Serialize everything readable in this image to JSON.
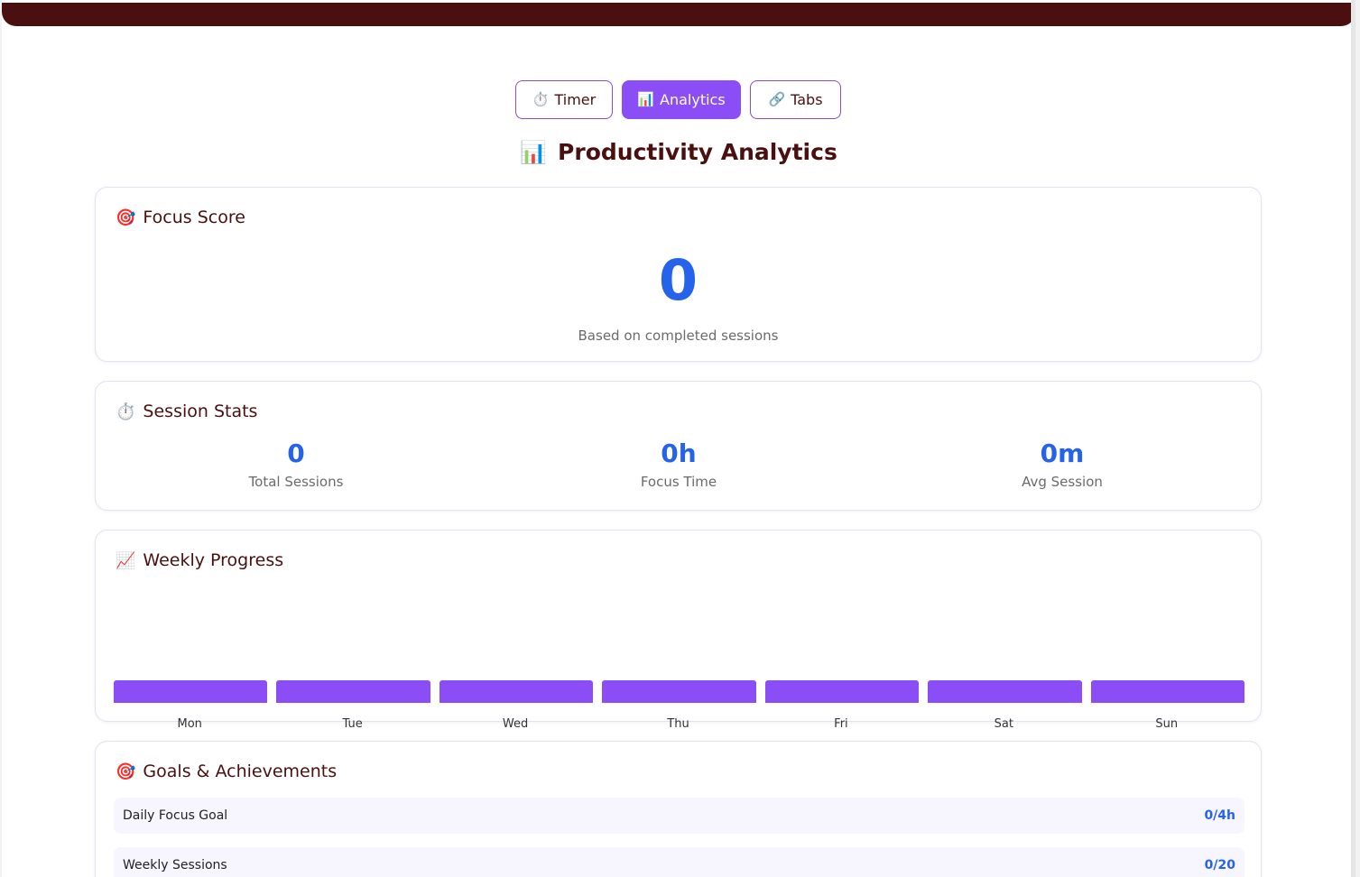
{
  "nav": {
    "tabs": [
      {
        "icon": "⏱️",
        "label": "Timer",
        "active": false
      },
      {
        "icon": "📊",
        "label": "Analytics",
        "active": true
      },
      {
        "icon": "🔗",
        "label": "Tabs",
        "active": false
      }
    ]
  },
  "page": {
    "title_icon": "📊",
    "title": "Productivity Analytics"
  },
  "focus_score": {
    "icon": "🎯",
    "title": "Focus Score",
    "value": "0",
    "note": "Based on completed sessions"
  },
  "session_stats": {
    "icon": "⏱️",
    "title": "Session Stats",
    "items": [
      {
        "value": "0",
        "label": "Total Sessions"
      },
      {
        "value": "0h",
        "label": "Focus Time"
      },
      {
        "value": "0m",
        "label": "Avg Session"
      }
    ]
  },
  "weekly_progress": {
    "icon": "📈",
    "title": "Weekly Progress",
    "bar_color": "#8b4df6"
  },
  "chart_data": {
    "type": "bar",
    "categories": [
      "Mon",
      "Tue",
      "Wed",
      "Thu",
      "Fri",
      "Sat",
      "Sun"
    ],
    "values": [
      0,
      0,
      0,
      0,
      0,
      0,
      0
    ],
    "title": "",
    "xlabel": "",
    "ylabel": ""
  },
  "goals": {
    "icon": "🎯",
    "title": "Goals & Achievements",
    "items": [
      {
        "label": "Daily Focus Goal",
        "value": "0/4h"
      },
      {
        "label": "Weekly Sessions",
        "value": "0/20"
      }
    ]
  },
  "colors": {
    "brand_dark": "#4a1010",
    "accent_purple": "#8b4df6",
    "value_blue": "#2563eb"
  }
}
